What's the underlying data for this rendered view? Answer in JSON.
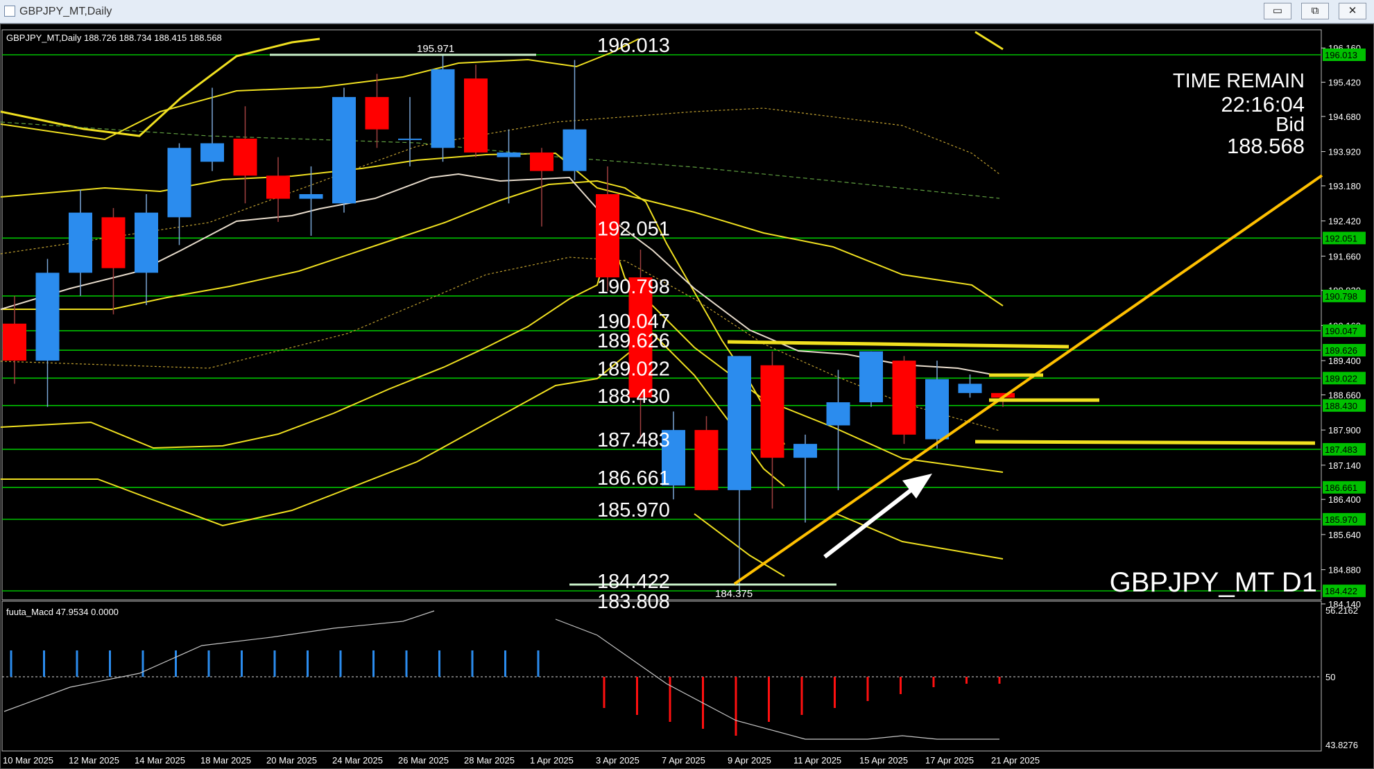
{
  "window": {
    "title": "GBPJPY_MT,Daily",
    "buttons": {
      "minimize": "▭",
      "maximize": "⧉",
      "close": "✕"
    }
  },
  "chart": {
    "info_line": "GBPJPY_MT,Daily  188.726 188.734 188.415 188.568",
    "overlay": {
      "time_remain_label": "TIME REMAIN",
      "time_remain_value": "22:16:04",
      "bid_label": "Bid",
      "bid_value": "188.568"
    },
    "symbol_watermark": "GBPJPY_MT D1",
    "swing_high_label": "195.971",
    "swing_low_label": "184.375",
    "cut_off_label": "183.808",
    "arrow": "white-up-arrow-icon",
    "colors": {
      "bull": "#2b8cee",
      "bear": "#ff0000",
      "level": "#00c000",
      "band": "#f0e020",
      "trend": "#ffc000"
    }
  },
  "levels": [
    {
      "value": "196.013"
    },
    {
      "value": "192.051"
    },
    {
      "value": "190.798"
    },
    {
      "value": "190.047"
    },
    {
      "value": "189.626"
    },
    {
      "value": "189.022"
    },
    {
      "value": "188.430"
    },
    {
      "value": "187.483"
    },
    {
      "value": "186.661"
    },
    {
      "value": "185.970"
    },
    {
      "value": "184.422"
    }
  ],
  "price_axis": [
    "196.160",
    "195.420",
    "194.680",
    "193.920",
    "193.180",
    "192.420",
    "191.660",
    "190.920",
    "190.160",
    "189.400",
    "188.660",
    "187.900",
    "187.140",
    "186.400",
    "185.640",
    "184.880",
    "184.140"
  ],
  "candles": [
    {
      "o": 190.2,
      "h": 190.8,
      "l": 188.9,
      "c": 189.4
    },
    {
      "o": 189.4,
      "h": 191.6,
      "l": 188.4,
      "c": 191.3
    },
    {
      "o": 191.3,
      "h": 193.1,
      "l": 190.8,
      "c": 192.6
    },
    {
      "o": 192.5,
      "h": 192.7,
      "l": 190.4,
      "c": 191.4
    },
    {
      "o": 191.3,
      "h": 193.0,
      "l": 190.6,
      "c": 192.6
    },
    {
      "o": 192.5,
      "h": 194.1,
      "l": 191.9,
      "c": 194.0
    },
    {
      "o": 193.7,
      "h": 195.3,
      "l": 193.5,
      "c": 194.1
    },
    {
      "o": 194.2,
      "h": 194.9,
      "l": 192.8,
      "c": 193.4
    },
    {
      "o": 193.4,
      "h": 193.8,
      "l": 192.4,
      "c": 192.9
    },
    {
      "o": 192.9,
      "h": 193.6,
      "l": 192.1,
      "c": 193.0
    },
    {
      "o": 192.8,
      "h": 195.3,
      "l": 192.6,
      "c": 195.1
    },
    {
      "o": 195.1,
      "h": 195.6,
      "l": 194.0,
      "c": 194.4
    },
    {
      "o": 194.2,
      "h": 195.1,
      "l": 193.6,
      "c": 194.2
    },
    {
      "o": 194.0,
      "h": 196.0,
      "l": 193.7,
      "c": 195.7
    },
    {
      "o": 195.5,
      "h": 195.8,
      "l": 193.8,
      "c": 193.9
    },
    {
      "o": 193.8,
      "h": 194.4,
      "l": 192.8,
      "c": 193.9
    },
    {
      "o": 193.9,
      "h": 194.0,
      "l": 192.3,
      "c": 193.5
    },
    {
      "o": 193.5,
      "h": 195.9,
      "l": 193.3,
      "c": 194.4
    },
    {
      "o": 193.0,
      "h": 193.6,
      "l": 190.9,
      "c": 191.2
    },
    {
      "o": 191.2,
      "h": 191.8,
      "l": 187.7,
      "c": 188.6
    },
    {
      "o": 186.7,
      "h": 188.3,
      "l": 186.4,
      "c": 187.9
    },
    {
      "o": 187.9,
      "h": 188.2,
      "l": 186.6,
      "c": 186.6
    },
    {
      "o": 186.6,
      "h": 189.5,
      "l": 184.4,
      "c": 189.5
    },
    {
      "o": 189.3,
      "h": 189.6,
      "l": 186.2,
      "c": 187.3
    },
    {
      "o": 187.3,
      "h": 187.8,
      "l": 185.9,
      "c": 187.6
    },
    {
      "o": 188.0,
      "h": 189.2,
      "l": 186.6,
      "c": 188.5
    },
    {
      "o": 188.5,
      "h": 189.6,
      "l": 188.4,
      "c": 189.6
    },
    {
      "o": 189.4,
      "h": 189.5,
      "l": 187.6,
      "c": 187.8
    },
    {
      "o": 187.7,
      "h": 189.4,
      "l": 187.5,
      "c": 189.0
    },
    {
      "o": 188.7,
      "h": 189.1,
      "l": 188.6,
      "c": 188.9
    },
    {
      "o": 188.7,
      "h": 188.7,
      "l": 188.4,
      "c": 188.6
    }
  ],
  "macd": {
    "label": "fuuta_Macd 47.9534  0.0000",
    "axis": [
      "56.2162",
      "50",
      "43.8276"
    ]
  },
  "dates": [
    "10 Mar 2025",
    "12 Mar 2025",
    "14 Mar 2025",
    "18 Mar 2025",
    "20 Mar 2025",
    "24 Mar 2025",
    "26 Mar 2025",
    "28 Mar 2025",
    "1 Apr 2025",
    "3 Apr 2025",
    "7 Apr 2025",
    "9 Apr 2025",
    "11 Apr 2025",
    "15 Apr 2025",
    "17 Apr 2025",
    "21 Apr 2025"
  ]
}
